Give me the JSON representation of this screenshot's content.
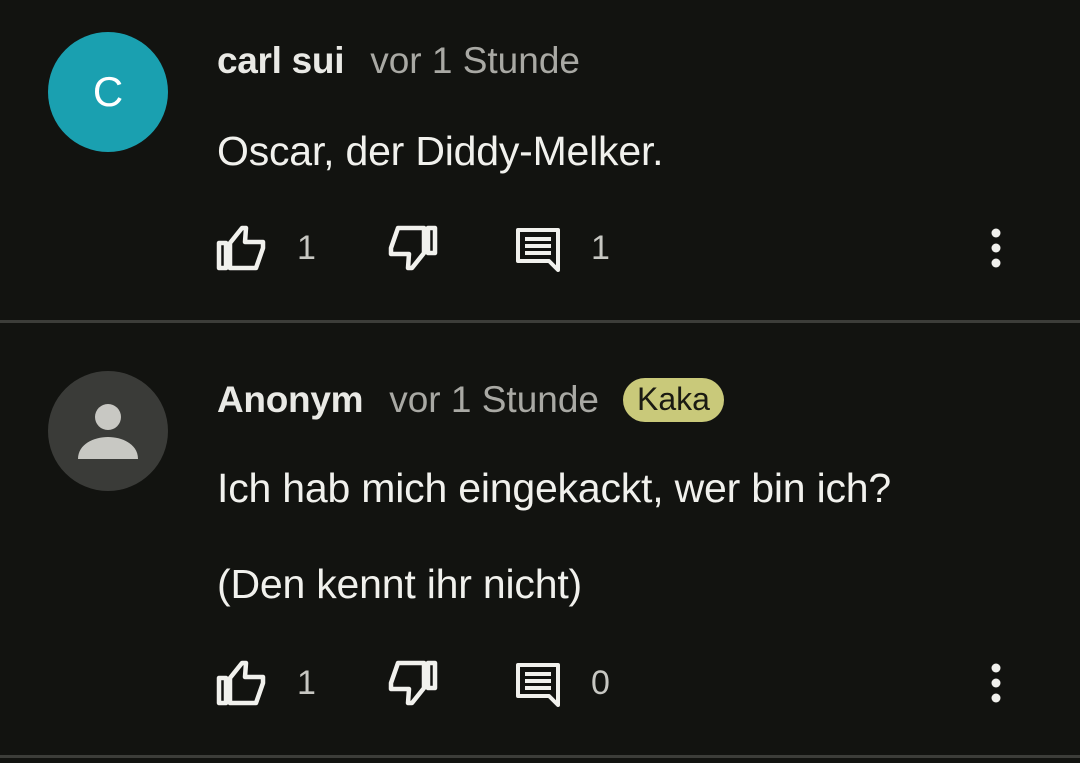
{
  "comments": [
    {
      "avatar": {
        "letter": "C",
        "color": "#1aa0b0"
      },
      "author": "carl sui",
      "time": "vor 1 Stunde",
      "badge": "",
      "lines": [
        "Oscar, der Diddy-Melker."
      ],
      "likes": "1",
      "replies": "1"
    },
    {
      "avatar": {
        "icon": "person-icon",
        "color": "#3a3b38"
      },
      "author": "Anonym",
      "time": "vor 1 Stunde",
      "badge": "Kaka",
      "lines": [
        "Ich hab mich eingekackt, wer bin ich?",
        "(Den kennt ihr nicht)"
      ],
      "likes": "1",
      "replies": "0"
    }
  ],
  "icons": {
    "like": "thumbs-up-icon",
    "dislike": "thumbs-down-icon",
    "reply": "comment-icon",
    "more": "more-vert-icon"
  },
  "colors": {
    "background": "#121310",
    "badge": "#c9c97a",
    "divider": "#3c3d39"
  }
}
